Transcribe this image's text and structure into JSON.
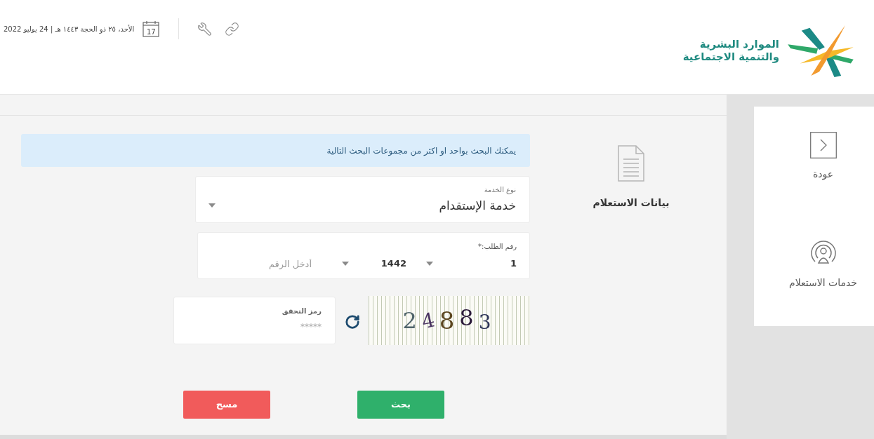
{
  "header": {
    "logo_lines": [
      "الموارد البشرية",
      "والتنمية الاجتماعية"
    ],
    "calendar_day": "17",
    "date": "الأحد، ٢٥ ذو الحجة ١٤٤٣ هـ | 24 يوليو 2022"
  },
  "sidebar": {
    "items": [
      {
        "kind": "back",
        "label": "عودة"
      },
      {
        "kind": "inquiry",
        "label": "خدمات الاستعلام"
      }
    ]
  },
  "section": {
    "title": "بيانات الاستعلام"
  },
  "form": {
    "notice": "يمكنك البحث بواحد او اكثر من مجموعات البحث التالية",
    "service_type": {
      "label": "نوع الخدمة",
      "value": "خدمة الإستقدام"
    },
    "request_number": {
      "label": "رقم الطلب:*",
      "parts": [
        {
          "kind": "select",
          "value": "1"
        },
        {
          "kind": "select",
          "value": "1442"
        },
        {
          "kind": "input",
          "placeholder": "أدخل الرقم"
        }
      ]
    },
    "captcha": {
      "text": "24883"
    },
    "verification": {
      "label": "رمز التحقق",
      "placeholder": "*****"
    },
    "buttons": [
      {
        "kind": "primary",
        "label": "بحث"
      },
      {
        "kind": "danger",
        "label": "مسح"
      }
    ]
  }
}
